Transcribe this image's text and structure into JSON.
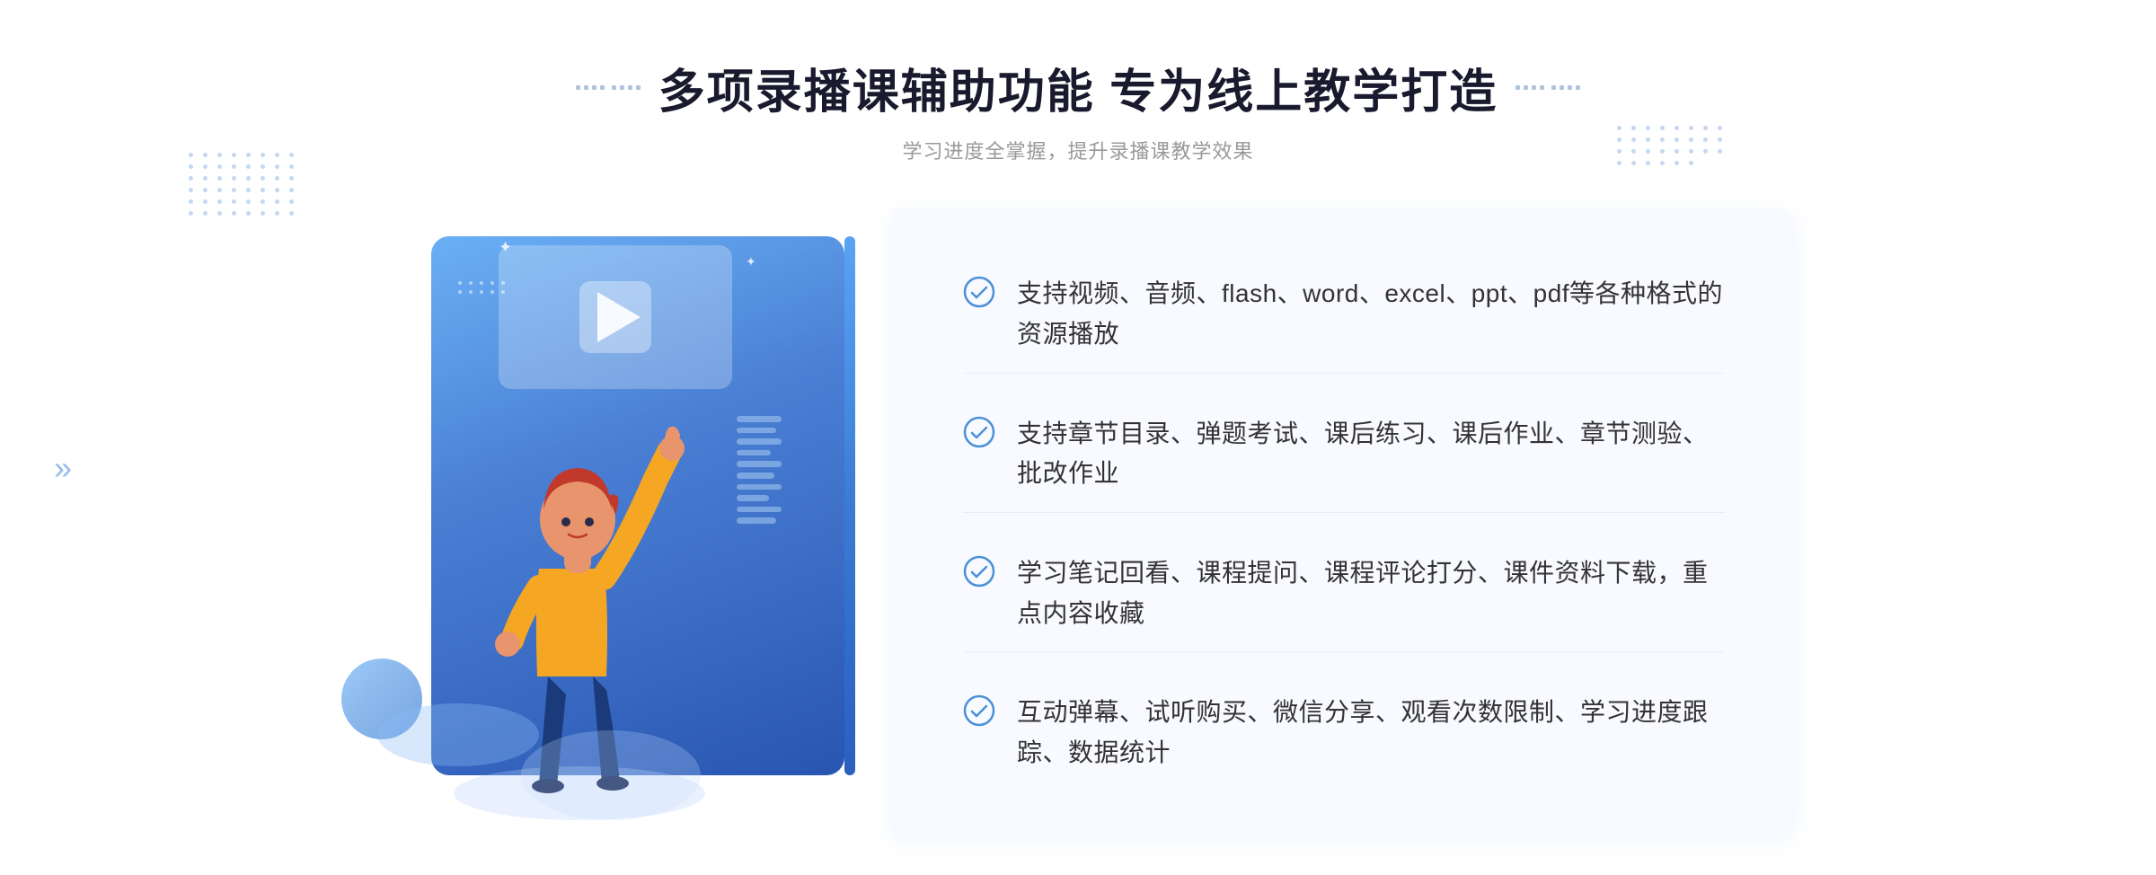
{
  "page": {
    "title": "多项录播课辅助功能 专为线上教学打造",
    "subtitle": "学习进度全掌握，提升录播课教学效果",
    "title_deco_left": "❖",
    "title_deco_right": "❖"
  },
  "features": [
    {
      "id": 1,
      "text": "支持视频、音频、flash、word、excel、ppt、pdf等各种格式的资源播放"
    },
    {
      "id": 2,
      "text": "支持章节目录、弹题考试、课后练习、课后作业、章节测验、批改作业"
    },
    {
      "id": 3,
      "text": "学习笔记回看、课程提问、课程评论打分、课件资料下载，重点内容收藏"
    },
    {
      "id": 4,
      "text": "互动弹幕、试听购买、微信分享、观看次数限制、学习进度跟踪、数据统计"
    }
  ],
  "colors": {
    "primary_blue": "#4a7fd4",
    "light_blue": "#6ab0f5",
    "accent_blue": "#3a6bc4",
    "text_dark": "#1a1a2e",
    "text_gray": "#999999",
    "text_body": "#333333",
    "check_color": "#4a90d9",
    "bg_features": "#f8faff"
  },
  "chevron": "»",
  "play_hint": "播放视频"
}
